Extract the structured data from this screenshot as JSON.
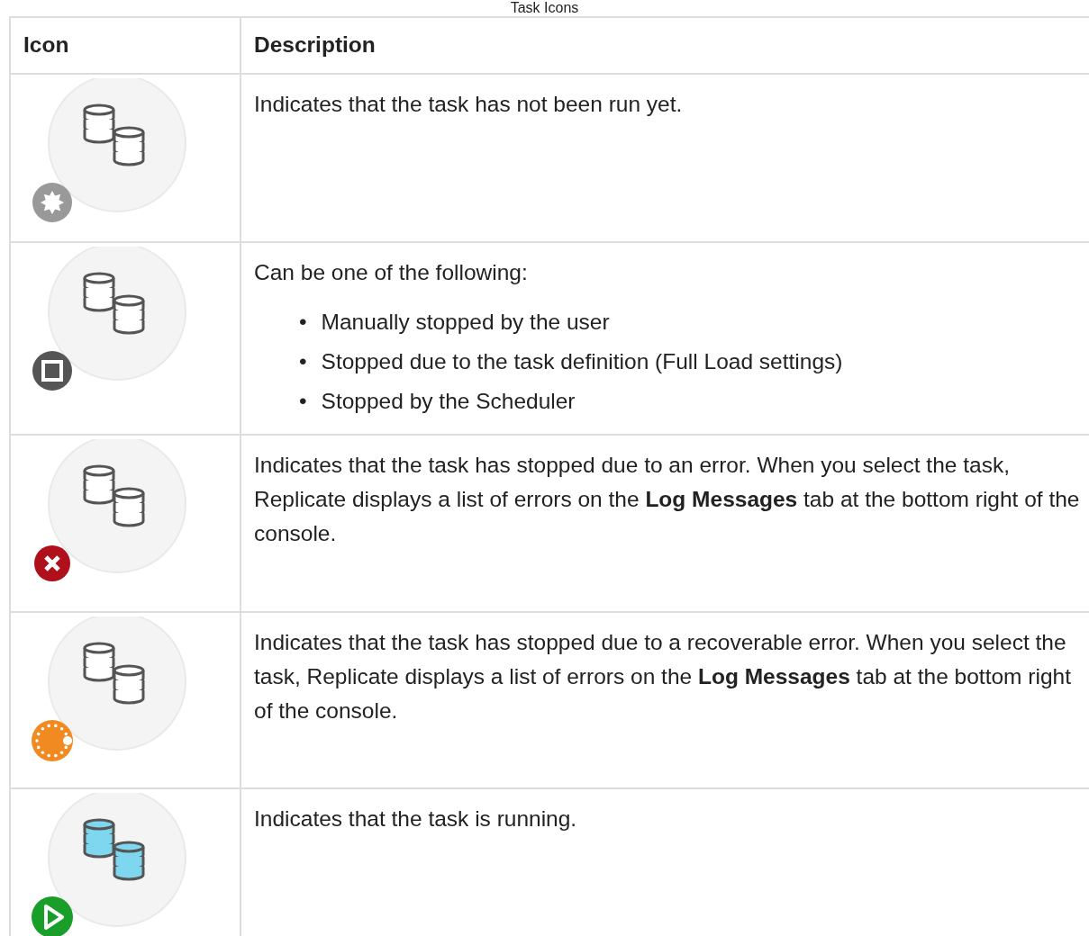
{
  "caption": "Task Icons",
  "table": {
    "columns": [
      "Icon",
      "Description"
    ],
    "rows": [
      {
        "icon": {
          "kind": "not-run"
        },
        "description": {
          "text": "Indicates that the task has not been run yet."
        }
      },
      {
        "icon": {
          "kind": "stopped"
        },
        "description": {
          "text": "Can be one of the following:",
          "bullets": [
            {
              "marker": "•",
              "text": "Manually stopped by the user"
            },
            {
              "marker": "•",
              "text": "Stopped due to the task definition (Full Load settings)"
            },
            {
              "marker": "•",
              "text": "Stopped by the Scheduler"
            }
          ]
        }
      },
      {
        "icon": {
          "kind": "error"
        },
        "description": {
          "text": "Indicates that the task has stopped due to an error. When you select the task, Replicate displays a list of errors on the **Log Messages** tab at the bottom right of the console."
        }
      },
      {
        "icon": {
          "kind": "recoverable-error"
        },
        "description": {
          "text": "Indicates that the task has stopped due to a recoverable error. When you select the task, Replicate displays a list of errors on the **Log Messages** tab at the bottom right of the console."
        }
      },
      {
        "icon": {
          "kind": "running"
        },
        "description": {
          "text": "Indicates that the task is running."
        }
      }
    ]
  }
}
